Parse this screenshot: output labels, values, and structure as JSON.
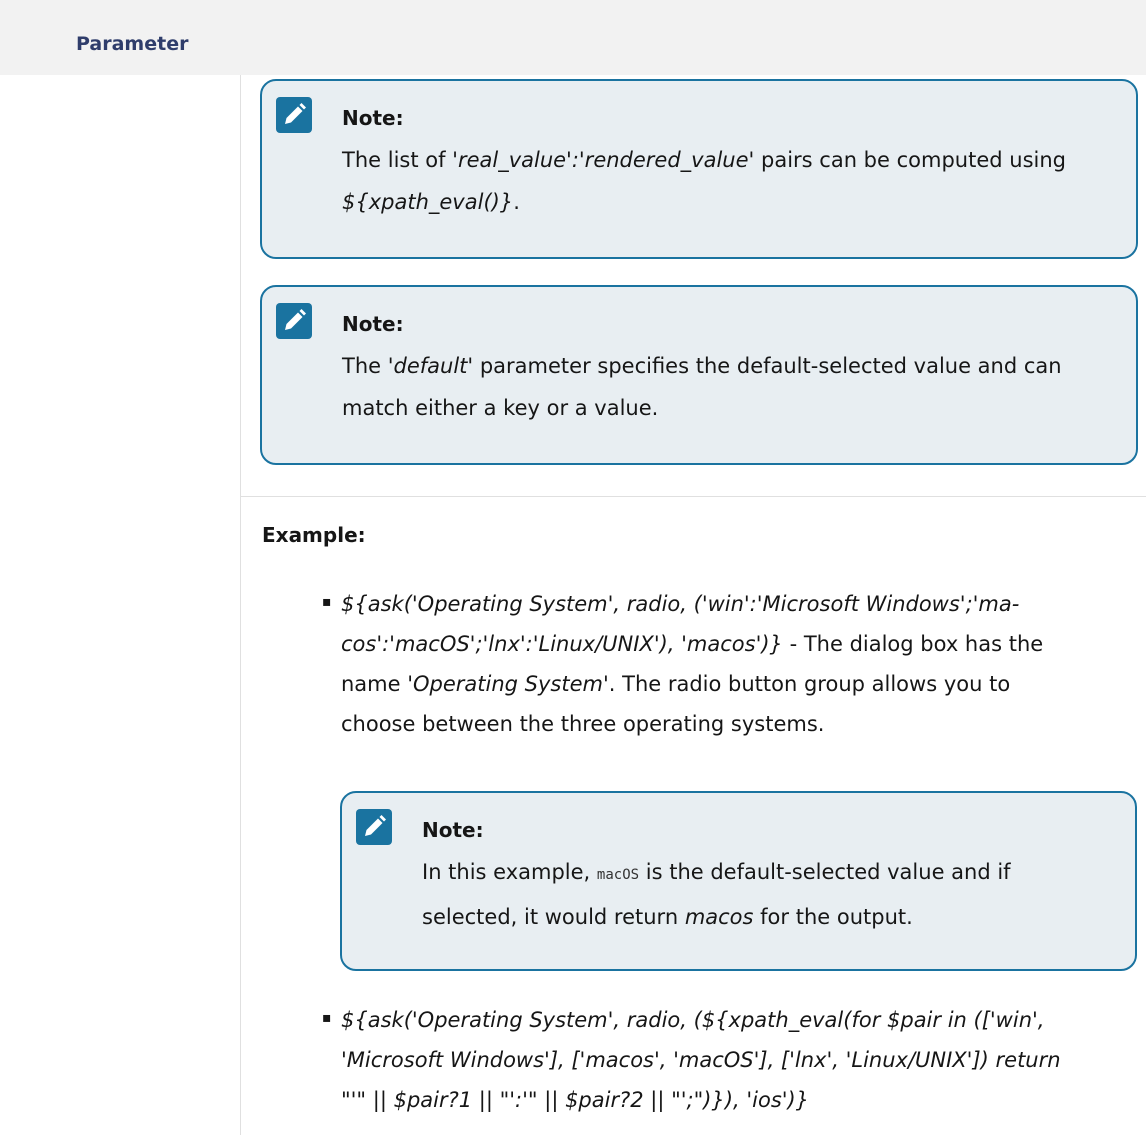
{
  "table": {
    "header": "Parameter"
  },
  "notes": [
    {
      "title": "Note:",
      "before": "The list of ",
      "em1": "'real_value':'rendered_value'",
      "middle": " pairs can be computed using ",
      "em2": "${xpath_eval()}",
      "after": "."
    },
    {
      "title": "Note:",
      "before": "The ",
      "em1": "'default'",
      "after": " parameter specifies the default-selected value and can match either a key or a value."
    }
  ],
  "example": {
    "label": "Example:",
    "items": [
      {
        "bullet": "▪",
        "code_line1": "${ask('Operating System', radio, ('win':'Microsoft Windows';'ma-",
        "code_line2": "cos':'macOS';'lnx':'Linux/UNIX'), 'macos')}",
        "text_a": " - The dialog box has the",
        "text_b": "name ",
        "em": "'Operating System'",
        "text_c": ". The radio button group allows you to",
        "text_d": "choose between the three operating systems."
      },
      {
        "bullet": "▪",
        "line1": "${ask('Operating System', radio, (${xpath_eval(for $pair in (['win',",
        "line2": "'Microsoft Windows'], ['macos', 'macOS'], ['lnx', 'Linux/UNIX']) return",
        "line3": "\"'\" || $pair?1 || \"':'\" || $pair?2 || \"';\")}), 'ios')}"
      }
    ],
    "note": {
      "title": "Note:",
      "before": "In this example, ",
      "code": "macOS",
      "middle": " is the default-selected value and if selected, it would return ",
      "em": "macos",
      "after": " for the output."
    }
  }
}
